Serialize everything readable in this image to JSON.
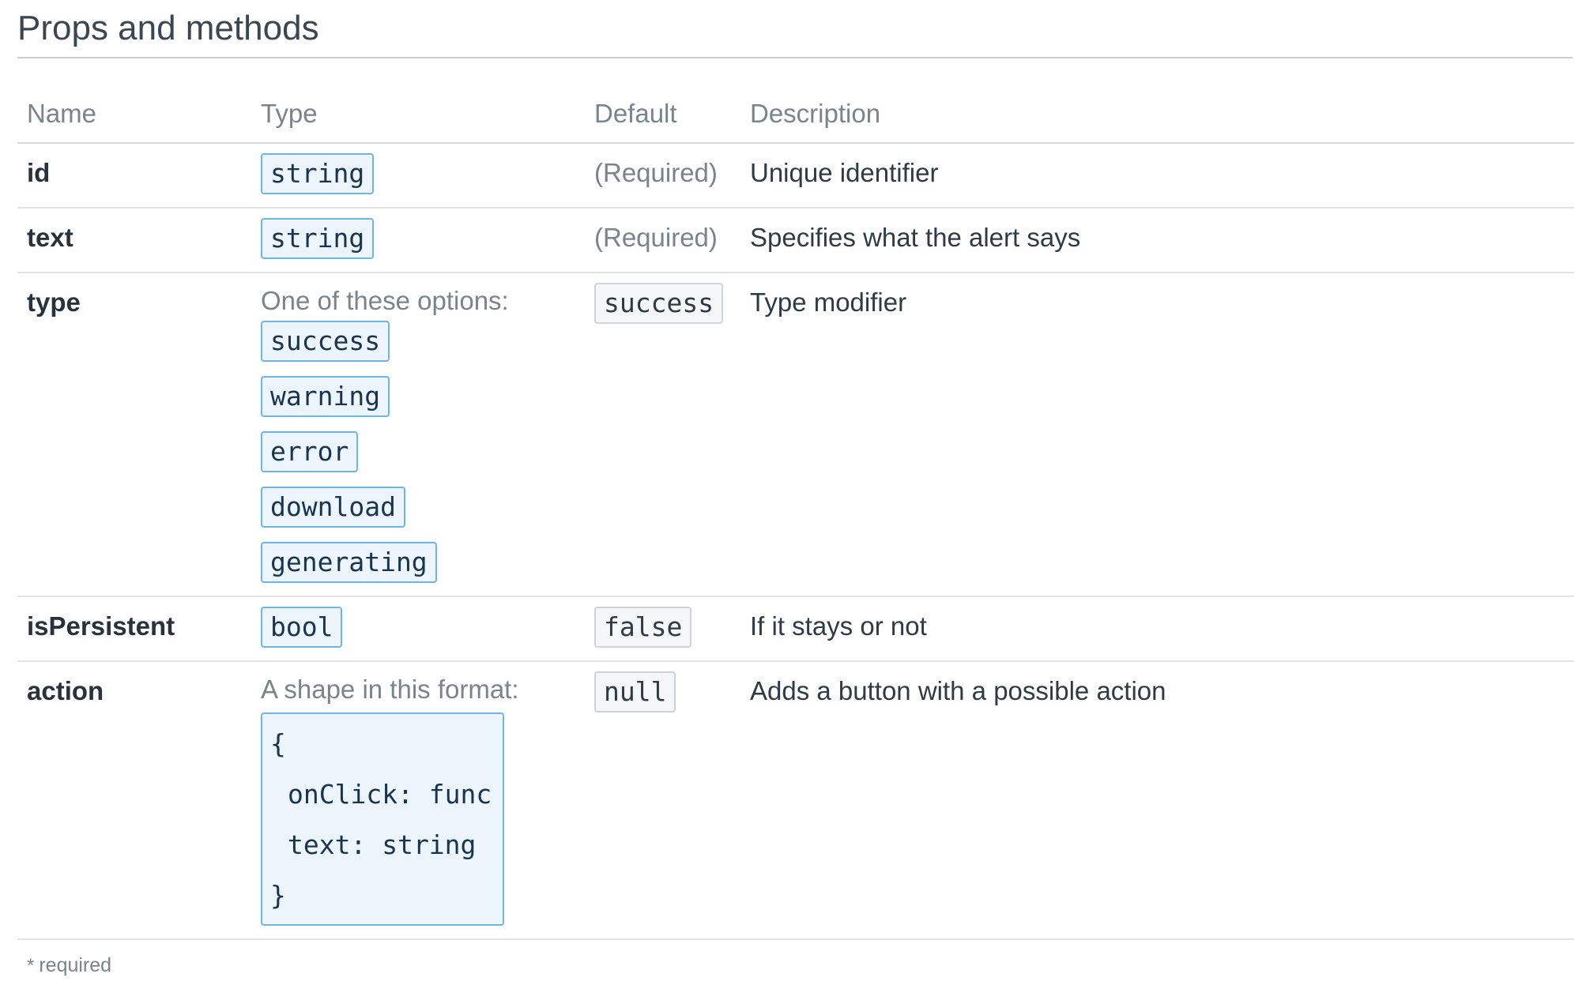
{
  "heading": "Props and methods",
  "columns": {
    "name": "Name",
    "type": "Type",
    "default": "Default",
    "description": "Description"
  },
  "rows": [
    {
      "name": "id",
      "type": "string",
      "default": "(Required)",
      "description": "Unique identifier"
    },
    {
      "name": "text",
      "type": "string",
      "default": "(Required)",
      "description": "Specifies what the alert says"
    },
    {
      "name": "type",
      "type_note": "One of these options:",
      "options": [
        "success",
        "warning",
        "error",
        "download",
        "generating"
      ],
      "default": "success",
      "description": "Type modifier"
    },
    {
      "name": "isPersistent",
      "type": "bool",
      "default": "false",
      "description": "If it stays or not"
    },
    {
      "name": "action",
      "type_note": "A shape in this format:",
      "shape": {
        "open": "{",
        "line1": "onClick: func",
        "line2": "text: string",
        "close": "}"
      },
      "default": "null",
      "description": "Adds a button with a possible action"
    }
  ],
  "footnote": {
    "star": "*",
    "text": "required"
  }
}
